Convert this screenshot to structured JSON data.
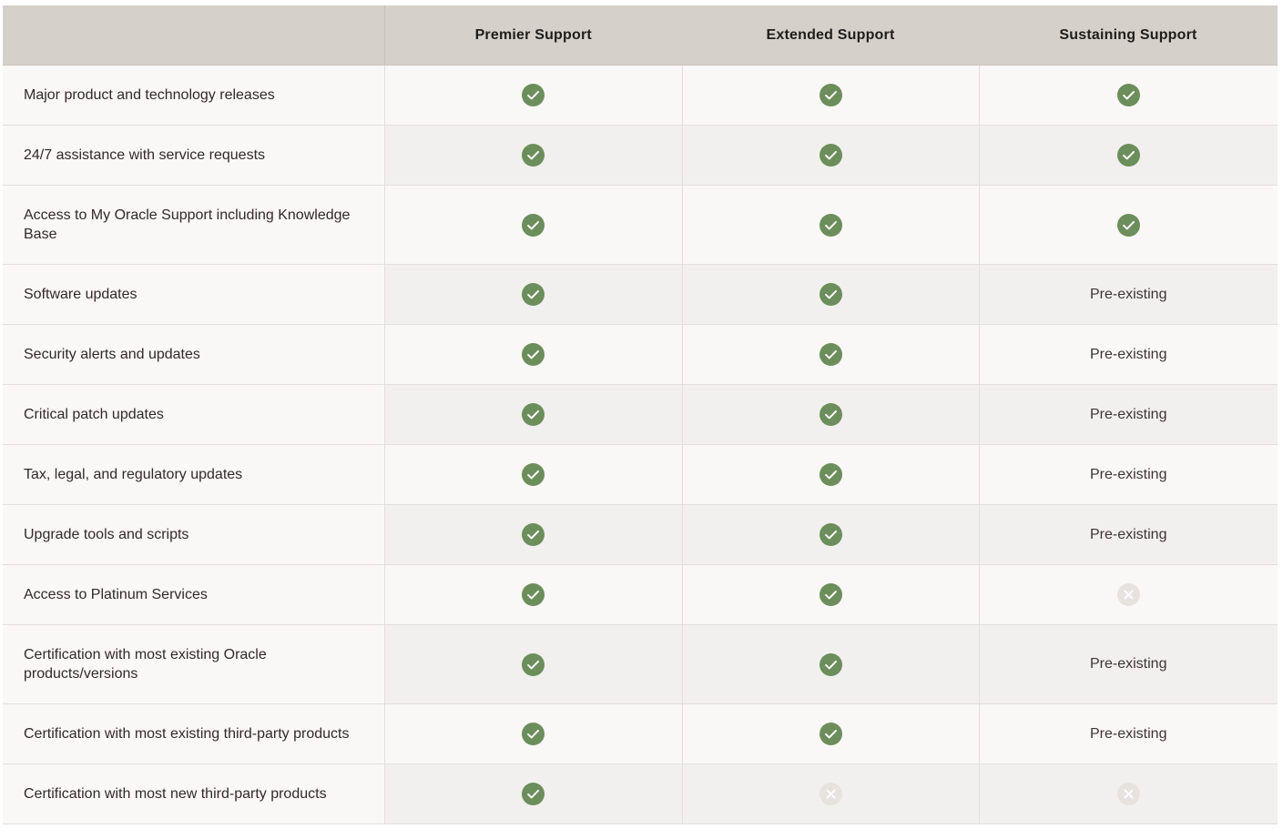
{
  "header": {
    "col0": "",
    "premier": "Premier Support",
    "extended": "Extended Support",
    "sustaining": "Sustaining Support"
  },
  "colors": {
    "check": "#6b8e5a",
    "cross": "#e6e3df",
    "header_bg": "#d5d0ca"
  },
  "rows": [
    {
      "feature": "Major product and technology releases",
      "premier": "check",
      "extended": "check",
      "sustaining": "check"
    },
    {
      "feature": "24/7 assistance with service requests",
      "premier": "check",
      "extended": "check",
      "sustaining": "check"
    },
    {
      "feature": "Access to My Oracle Support including Knowledge Base",
      "premier": "check",
      "extended": "check",
      "sustaining": "check"
    },
    {
      "feature": "Software updates",
      "premier": "check",
      "extended": "check",
      "sustaining": "Pre-existing"
    },
    {
      "feature": "Security alerts and updates",
      "premier": "check",
      "extended": "check",
      "sustaining": "Pre-existing"
    },
    {
      "feature": "Critical patch updates",
      "premier": "check",
      "extended": "check",
      "sustaining": "Pre-existing"
    },
    {
      "feature": "Tax, legal, and regulatory updates",
      "premier": "check",
      "extended": "check",
      "sustaining": "Pre-existing"
    },
    {
      "feature": "Upgrade tools and scripts",
      "premier": "check",
      "extended": "check",
      "sustaining": "Pre-existing"
    },
    {
      "feature": "Access to Platinum Services",
      "premier": "check",
      "extended": "check",
      "sustaining": "cross"
    },
    {
      "feature": "Certification with most existing Oracle products/versions",
      "premier": "check",
      "extended": "check",
      "sustaining": "Pre-existing"
    },
    {
      "feature": "Certification with most existing third-party products",
      "premier": "check",
      "extended": "check",
      "sustaining": "Pre-existing"
    },
    {
      "feature": "Certification with most new third-party products",
      "premier": "check",
      "extended": "cross",
      "sustaining": "cross"
    }
  ]
}
